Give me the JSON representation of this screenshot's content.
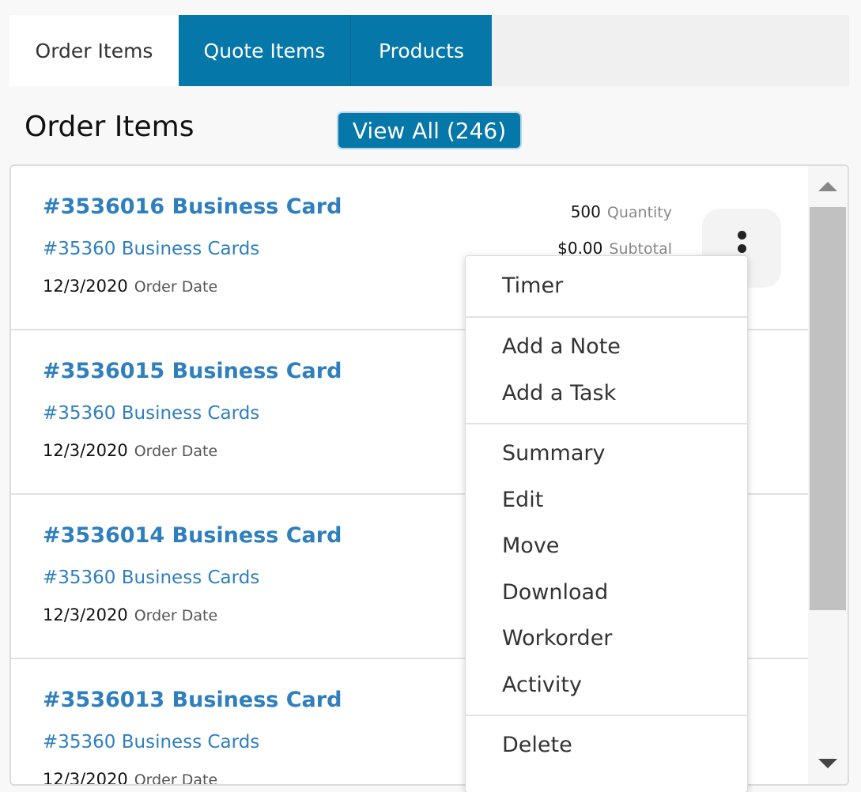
{
  "tabs": [
    {
      "label": "Order Items"
    },
    {
      "label": "Quote Items"
    },
    {
      "label": "Products"
    }
  ],
  "header": {
    "title": "Order Items",
    "view_all_label": "View All (246)"
  },
  "labels": {
    "order_date": "Order Date",
    "quantity": "Quantity",
    "subtotal": "Subtotal"
  },
  "rows": [
    {
      "title": "#3536016 Business Card",
      "subtitle": "#35360 Business Cards",
      "date": "12/3/2020",
      "quantity": "500",
      "subtotal": "$0.00"
    },
    {
      "title": "#3536015 Business Card",
      "subtitle": "#35360 Business Cards",
      "date": "12/3/2020"
    },
    {
      "title": "#3536014 Business Card",
      "subtitle": "#35360 Business Cards",
      "date": "12/3/2020"
    },
    {
      "title": "#3536013 Business Card",
      "subtitle": "#35360 Business Cards",
      "date": "12/3/2020"
    }
  ],
  "menu": {
    "groups": [
      [
        "Timer"
      ],
      [
        "Add a Note",
        "Add a Task"
      ],
      [
        "Summary",
        "Edit",
        "Move",
        "Download",
        "Workorder",
        "Activity"
      ],
      [
        "Delete"
      ]
    ]
  },
  "icons": {
    "kebab": "vertical-ellipsis-icon",
    "scroll_up": "triangle-up-icon",
    "scroll_down": "triangle-down-icon"
  },
  "colors": {
    "brand_blue": "#0577a8",
    "link_blue": "#2f7fbe"
  }
}
